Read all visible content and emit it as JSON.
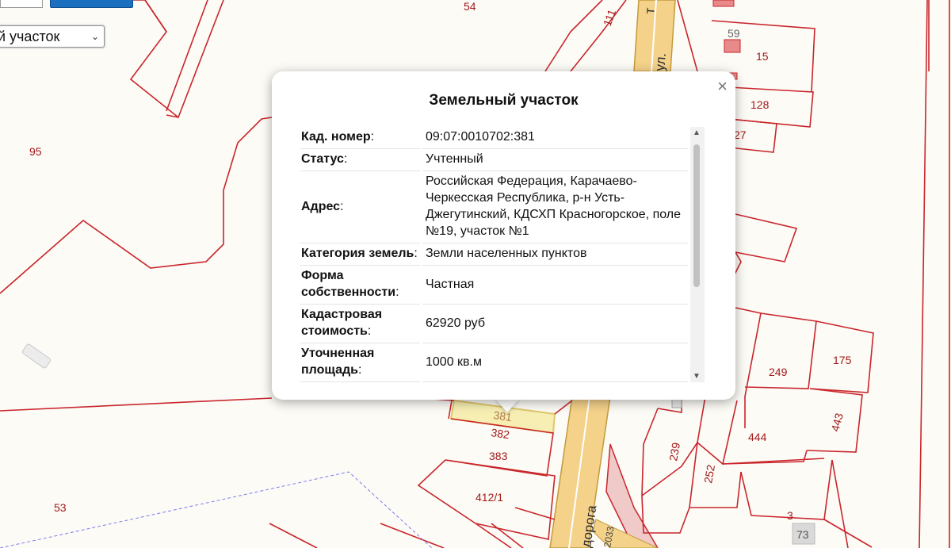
{
  "map": {
    "parcel_labels": [
      "54",
      "111",
      "59",
      "15",
      "128",
      "27",
      "95",
      "249",
      "175",
      "443",
      "444",
      "252",
      "239",
      "3",
      "73",
      "53",
      "412/1",
      "381",
      "382",
      "383",
      "2033"
    ],
    "road_labels": {
      "top_street": "ул.",
      "bottom_road": "дорога"
    },
    "colors": {
      "boundary": "#c9262c",
      "road_fill": "#f4d28a",
      "road_edge": "#c49a3a",
      "background": "#fcfbf6",
      "selected_parcel": "#f6eeb2"
    }
  },
  "layer_select": {
    "value": "й участок"
  },
  "popup": {
    "title": "Земельный участок",
    "close_icon": "×",
    "rows": [
      {
        "key": "Кад. номер",
        "value": "09:07:0010702:381"
      },
      {
        "key": "Статус",
        "value": "Учтенный"
      },
      {
        "key": "Адрес",
        "value": "Российская Федерация, Карачаево-Черкесская Республика, р-н Усть-Джегутинский, КДСХП Красногорское, поле №19, участок №1"
      },
      {
        "key": "Категория земель",
        "value": "Земли населенных пунктов"
      },
      {
        "key": "Форма собственности",
        "value": "Частная"
      },
      {
        "key": "Кадастровая стоимость",
        "value": "62920 руб"
      },
      {
        "key": "Уточненная площадь",
        "value": "1000 кв.м"
      }
    ]
  }
}
